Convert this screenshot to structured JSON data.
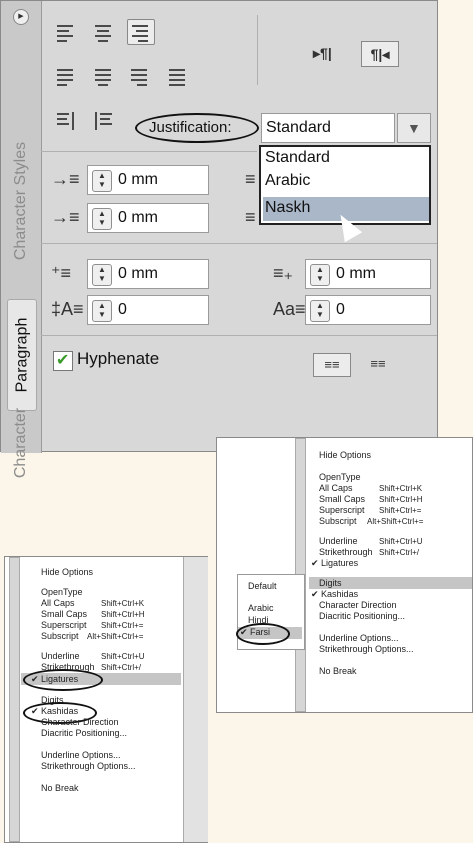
{
  "main_panel": {
    "tabs": [
      "Character Styles",
      "Paragraph",
      "Character"
    ],
    "justification_label": "Justification:",
    "justification_value": "Standard",
    "dropdown_options": [
      "Standard",
      "Arabic",
      "Naskh"
    ],
    "indent_left": "0 mm",
    "indent_first": "0 mm",
    "space_before": "0 mm",
    "space_after": "0 mm",
    "drop_cap_lines": "0",
    "drop_cap_chars": "0",
    "hyphenate_label": "Hyphenate"
  },
  "left_menu": {
    "items": {
      "hide": "Hide Options",
      "opentype": "OpenType",
      "allcaps": "All Caps",
      "smallcaps": "Small Caps",
      "superscript": "Superscript",
      "subscript": "Subscript",
      "underline": "Underline",
      "strike": "Strikethrough",
      "ligatures": "Ligatures",
      "digits": "Digits",
      "kashidas": "Kashidas",
      "chardir": "Character Direction",
      "diacritic": "Diacritic Positioning...",
      "underline_opts": "Underline Options...",
      "strike_opts": "Strikethrough Options...",
      "nobreak": "No Break"
    },
    "shortcuts": {
      "allcaps": "Shift+Ctrl+K",
      "smallcaps": "Shift+Ctrl+H",
      "superscript": "Shift+Ctrl+=",
      "subscript": "Alt+Shift+Ctrl+=",
      "underline": "Shift+Ctrl+U",
      "strike": "Shift+Ctrl+/"
    }
  },
  "right_menu": {
    "items": {
      "hide": "Hide Options",
      "opentype": "OpenType",
      "allcaps": "All Caps",
      "smallcaps": "Small Caps",
      "superscript": "Superscript",
      "subscript": "Subscript",
      "underline": "Underline",
      "strike": "Strikethrough",
      "ligatures": "Ligatures",
      "digits": "Digits",
      "kashidas": "Kashidas",
      "chardir": "Character Direction",
      "diacritic": "Diacritic Positioning...",
      "underline_opts": "Underline Options...",
      "strike_opts": "Strikethrough Options...",
      "nobreak": "No Break"
    },
    "shortcuts": {
      "allcaps": "Shift+Ctrl+K",
      "smallcaps": "Shift+Ctrl+H",
      "superscript": "Shift+Ctrl+=",
      "subscript": "Alt+Shift+Ctrl+=",
      "underline": "Shift+Ctrl+U",
      "strike": "Shift+Ctrl+/"
    },
    "submenu": [
      "Default",
      "Arabic",
      "Hindi",
      "Farsi"
    ]
  }
}
